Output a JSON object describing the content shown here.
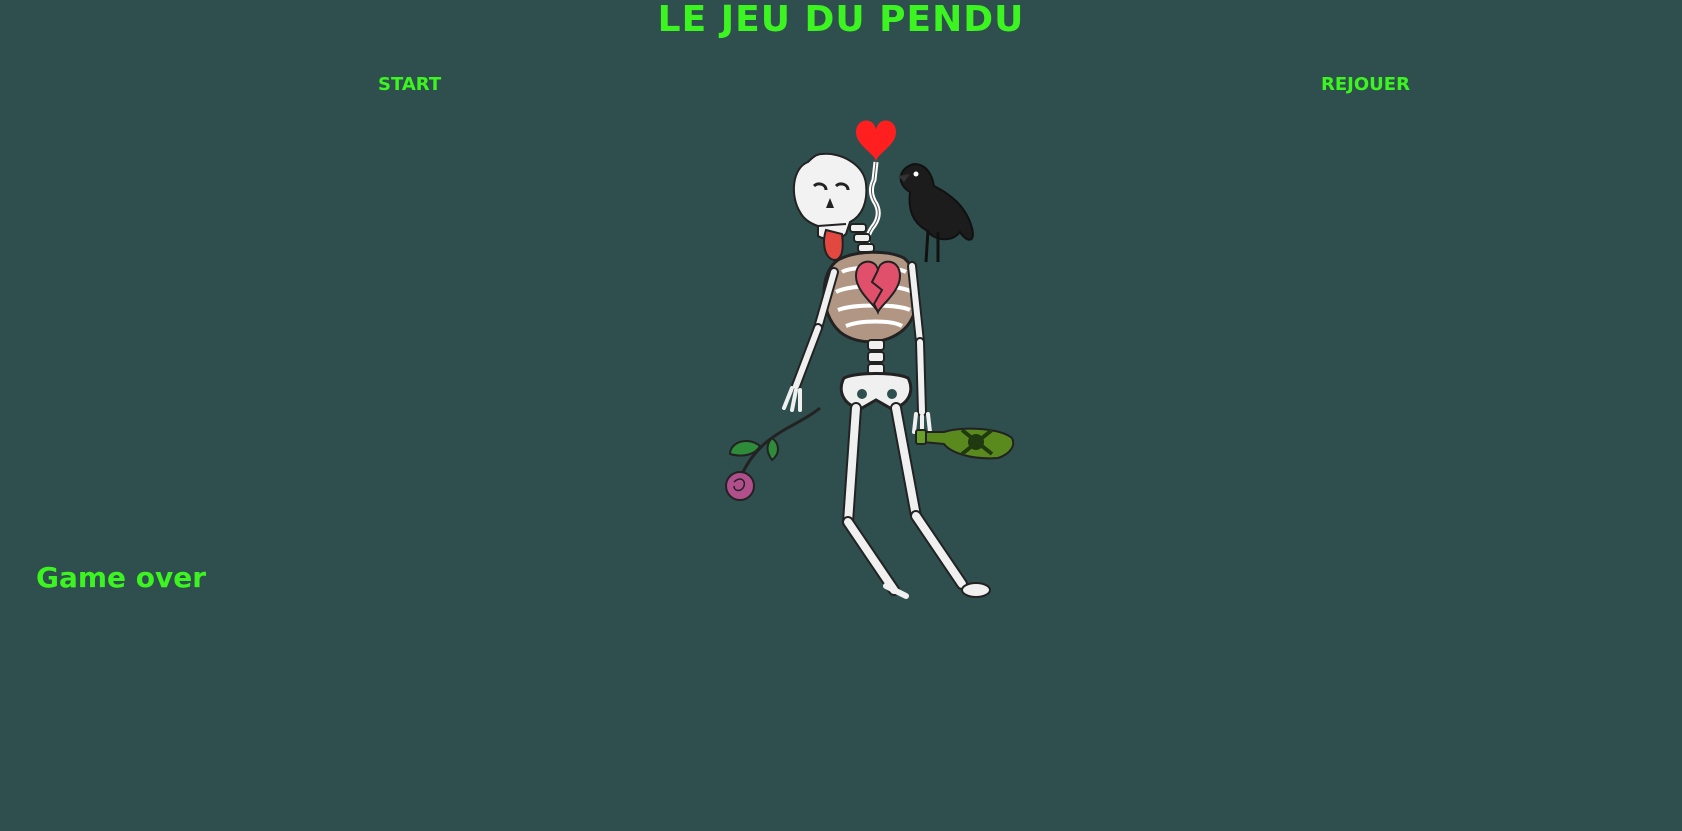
{
  "game": {
    "title": "LE JEU DU PENDU",
    "start_label": "START",
    "replay_label": "REJOUER",
    "status_text": "Game over"
  },
  "colors": {
    "background": "#2f4f4f",
    "accent": "#3cf41f"
  },
  "illustration": {
    "icon": "hanged-skeleton-illustration"
  }
}
